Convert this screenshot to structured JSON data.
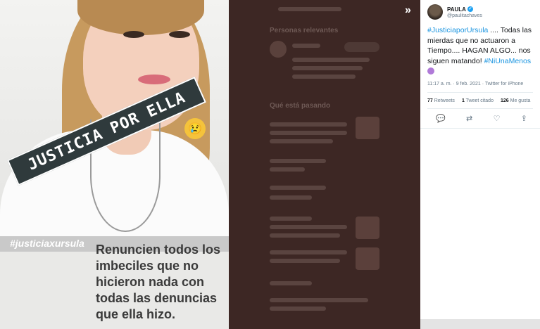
{
  "story": {
    "banner": "JUSTICIA POR ELLA",
    "hashtag": "#justiciaxursula",
    "text": "Renuncien todos los imbeciles que no hicieron nada con todas las denuncias que ella hizo."
  },
  "backdrop": {
    "nav_icon": "double-chevron-right-icon",
    "sections": {
      "relevant_people": "Personas relevantes",
      "whats_happening": "Qué está pasando"
    }
  },
  "tweet": {
    "display_name": "PAULA",
    "handle": "@paulitachaves",
    "body": {
      "hashtag1": "#JusticiaporUrsula",
      "text": " .... Todas las mierdas que no actuaron a Tiempo....  HAGAN ALGO... nos siguen matando! ",
      "hashtag2": "#NiUnaMenos"
    },
    "meta": "11:17 a. m. · 9 feb. 2021 · Twitter for iPhone",
    "stats": {
      "retweets_count": "77",
      "retweets_label": "Retweets",
      "quotes_count": "1",
      "quotes_label": "Tweet citado",
      "likes_count": "126",
      "likes_label": "Me gusta"
    },
    "actions": [
      "reply-icon",
      "retweet-icon",
      "like-icon",
      "share-icon"
    ],
    "colors": {
      "link": "#1b95e0",
      "verified": "#1da1f2"
    }
  }
}
